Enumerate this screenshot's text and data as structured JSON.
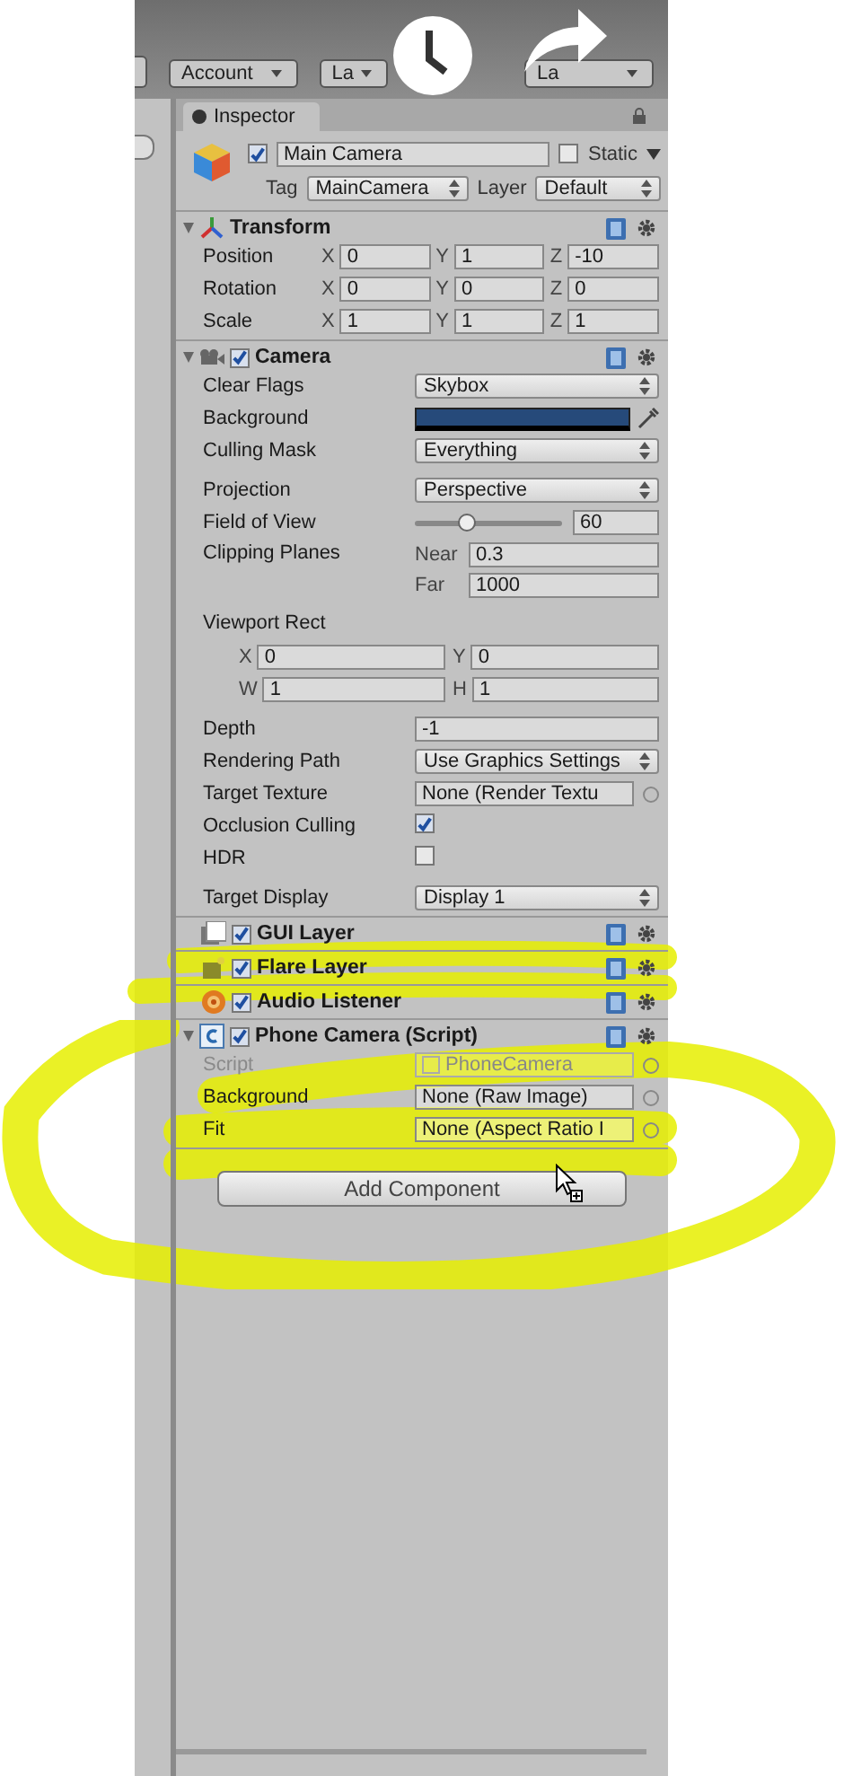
{
  "toolbar": {
    "buttons": [
      {
        "label": "Account"
      },
      {
        "label": "La"
      },
      {
        "label": "La"
      }
    ]
  },
  "inspector": {
    "tab": "Inspector",
    "object": {
      "active": true,
      "name": "Main Camera",
      "static_label": "Static",
      "static": false,
      "tag_label": "Tag",
      "tag": "MainCamera",
      "layer_label": "Layer",
      "layer": "Default"
    },
    "components": [
      {
        "kind": "transform",
        "title": "Transform",
        "expanded": true,
        "sections": [
          [
            {
              "kind": "vector3",
              "label": "Position",
              "axes": [
                {
                  "axis": "X",
                  "value": "0"
                },
                {
                  "axis": "Y",
                  "value": "1"
                },
                {
                  "axis": "Z",
                  "value": "-10"
                }
              ]
            },
            {
              "kind": "vector3",
              "label": "Rotation",
              "axes": [
                {
                  "axis": "X",
                  "value": "0"
                },
                {
                  "axis": "Y",
                  "value": "0"
                },
                {
                  "axis": "Z",
                  "value": "0"
                }
              ]
            },
            {
              "kind": "vector3",
              "label": "Scale",
              "axes": [
                {
                  "axis": "X",
                  "value": "1"
                },
                {
                  "axis": "Y",
                  "value": "1"
                },
                {
                  "axis": "Z",
                  "value": "1"
                }
              ]
            }
          ]
        ]
      },
      {
        "kind": "camera",
        "title": "Camera",
        "expanded": true,
        "enabled": true,
        "sections": [
          [
            {
              "kind": "dropdown",
              "label": "Clear Flags",
              "value": "Skybox"
            },
            {
              "kind": "color",
              "label": "Background",
              "color": "#264a7a"
            },
            {
              "kind": "dropdown",
              "label": "Culling Mask",
              "value": "Everything"
            }
          ],
          [
            {
              "kind": "dropdown",
              "label": "Projection",
              "value": "Perspective"
            },
            {
              "kind": "slider",
              "label": "Field of View",
              "level": 0.35,
              "value": "60"
            },
            {
              "kind": "nearfar",
              "label": "Clipping Planes",
              "parts": [
                {
                  "axis": "Near",
                  "value": "0.3"
                },
                {
                  "axis": "Far",
                  "value": "1000"
                }
              ]
            }
          ],
          [
            {
              "kind": "rect",
              "label": "Viewport Rect",
              "lines": [
                [
                  {
                    "axis": "X",
                    "value": "0"
                  },
                  {
                    "axis": "Y",
                    "value": "0"
                  }
                ],
                [
                  {
                    "axis": "W",
                    "value": "1"
                  },
                  {
                    "axis": "H",
                    "value": "1"
                  }
                ]
              ]
            }
          ],
          [
            {
              "kind": "field",
              "label": "Depth",
              "value": "-1"
            },
            {
              "kind": "dropdown",
              "label": "Rendering Path",
              "value": "Use Graphics Settings"
            },
            {
              "kind": "object",
              "label": "Target Texture",
              "value": "None (Render Textu"
            },
            {
              "kind": "checkbox",
              "label": "Occlusion Culling",
              "checked": true
            },
            {
              "kind": "checkbox",
              "label": "HDR",
              "checked": false
            }
          ],
          [
            {
              "kind": "dropdown",
              "label": "Target Display",
              "value": "Display 1"
            }
          ]
        ]
      },
      {
        "kind": "gui_layer",
        "title": "GUI Layer",
        "enabled": true
      },
      {
        "kind": "flare_layer",
        "title": "Flare Layer",
        "enabled": true
      },
      {
        "kind": "audio_listener",
        "title": "Audio Listener",
        "enabled": true
      },
      {
        "kind": "script",
        "title": "Phone Camera (Script)",
        "expanded": true,
        "enabled": true,
        "sections": [
          [
            {
              "kind": "object",
              "label": "Script",
              "value": "PhoneCamera",
              "disabled": true
            },
            {
              "kind": "object",
              "label": "Background",
              "value": "None (Raw Image)"
            },
            {
              "kind": "object",
              "label": "Fit",
              "value": "None (Aspect Ratio I"
            }
          ]
        ]
      }
    ],
    "add_button": "Add Component"
  }
}
